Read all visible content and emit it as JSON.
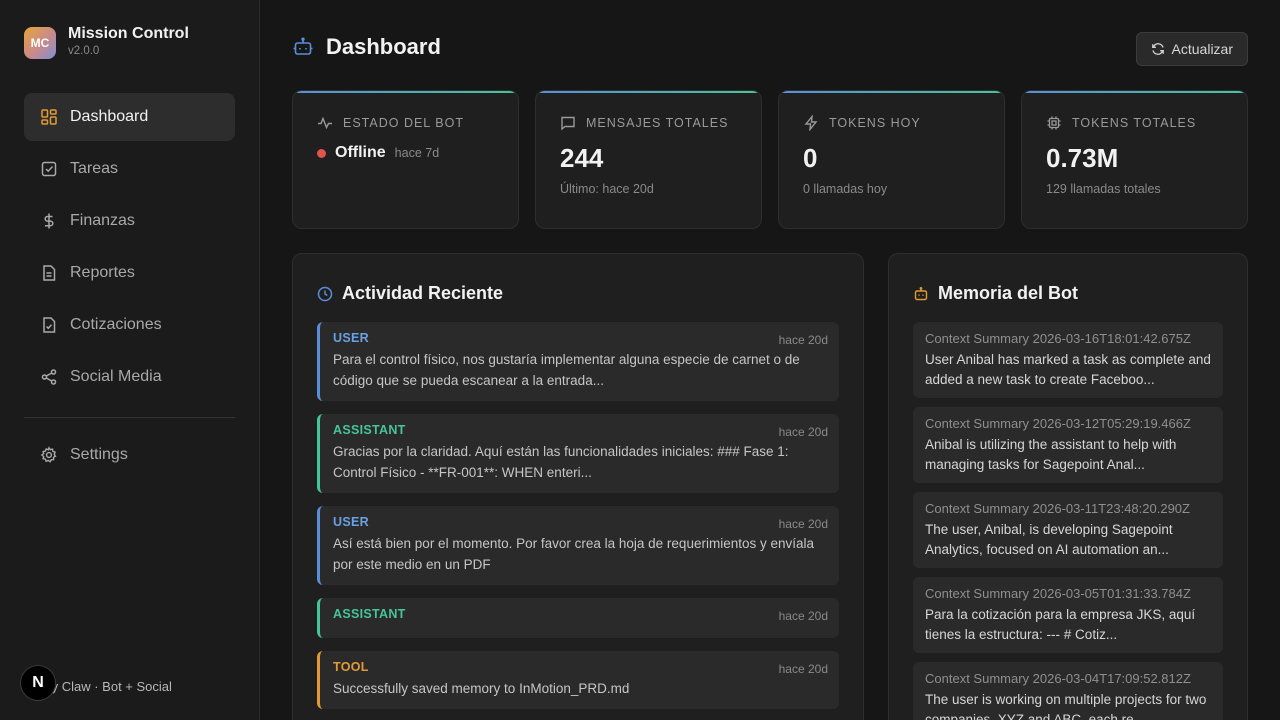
{
  "brand": {
    "logo": "MC",
    "name": "Mission Control",
    "version": "v2.0.0"
  },
  "nav": {
    "items": [
      {
        "label": "Dashboard",
        "icon": "dashboard-grid-icon",
        "active": true
      },
      {
        "label": "Tareas",
        "icon": "checkbox-icon"
      },
      {
        "label": "Finanzas",
        "icon": "dollar-icon"
      },
      {
        "label": "Reportes",
        "icon": "document-icon"
      },
      {
        "label": "Cotizaciones",
        "icon": "document-check-icon"
      },
      {
        "label": "Social Media",
        "icon": "share-icon"
      }
    ],
    "settings_label": "Settings"
  },
  "footer": {
    "text": "ty Claw · Bot + Social",
    "badge": "N"
  },
  "header": {
    "title": "Dashboard",
    "refresh_label": "Actualizar"
  },
  "stats": {
    "bot_status": {
      "label": "ESTADO DEL BOT",
      "status": "Offline",
      "ago": "hace 7d",
      "status_color": "#e0534f"
    },
    "messages": {
      "label": "MENSAJES TOTALES",
      "value": "244",
      "sub": "Último: hace 20d"
    },
    "tokens_today": {
      "label": "TOKENS HOY",
      "value": "0",
      "sub": "0 llamadas hoy"
    },
    "tokens_total": {
      "label": "TOKENS TOTALES",
      "value": "0.73M",
      "sub": "129 llamadas totales"
    }
  },
  "activity": {
    "title": "Actividad Reciente",
    "items": [
      {
        "role": "USER",
        "time": "hace 20d",
        "text": "Para el control físico, nos gustaría implementar alguna especie de carnet o de código que se pueda escanear a la entrada..."
      },
      {
        "role": "ASSISTANT",
        "time": "hace 20d",
        "text": "Gracias por la claridad. Aquí están las funcionalidades iniciales: ### Fase 1: Control Físico - **FR-001**: WHEN enteri..."
      },
      {
        "role": "USER",
        "time": "hace 20d",
        "text": "Así está bien por el momento. Por favor crea la hoja de requerimientos y envíala por este medio en un PDF"
      },
      {
        "role": "ASSISTANT",
        "time": "hace 20d",
        "text": ""
      },
      {
        "role": "TOOL",
        "time": "hace 20d",
        "text": "Successfully saved memory to InMotion_PRD.md"
      }
    ]
  },
  "memory": {
    "title": "Memoria del Bot",
    "items": [
      {
        "title": "Context Summary 2026-03-16T18:01:42.675Z",
        "text": "User Anibal has marked a task as complete and added a new task to create Faceboo..."
      },
      {
        "title": "Context Summary 2026-03-12T05:29:19.466Z",
        "text": "Anibal is utilizing the assistant to help with managing tasks for Sagepoint Anal..."
      },
      {
        "title": "Context Summary 2026-03-11T23:48:20.290Z",
        "text": "The user, Anibal, is developing Sagepoint Analytics, focused on AI automation an..."
      },
      {
        "title": "Context Summary 2026-03-05T01:31:33.784Z",
        "text": "Para la cotización para la empresa JKS, aquí tienes la estructura: --- # Cotiz..."
      },
      {
        "title": "Context Summary 2026-03-04T17:09:52.812Z",
        "text": "The user is working on multiple projects for two companies, XYZ and ABC, each re..."
      }
    ]
  },
  "colors": {
    "accent_blue": "#5a8fd8",
    "accent_green": "#46c49a",
    "accent_orange": "#e39a36",
    "status_red": "#e0534f"
  }
}
